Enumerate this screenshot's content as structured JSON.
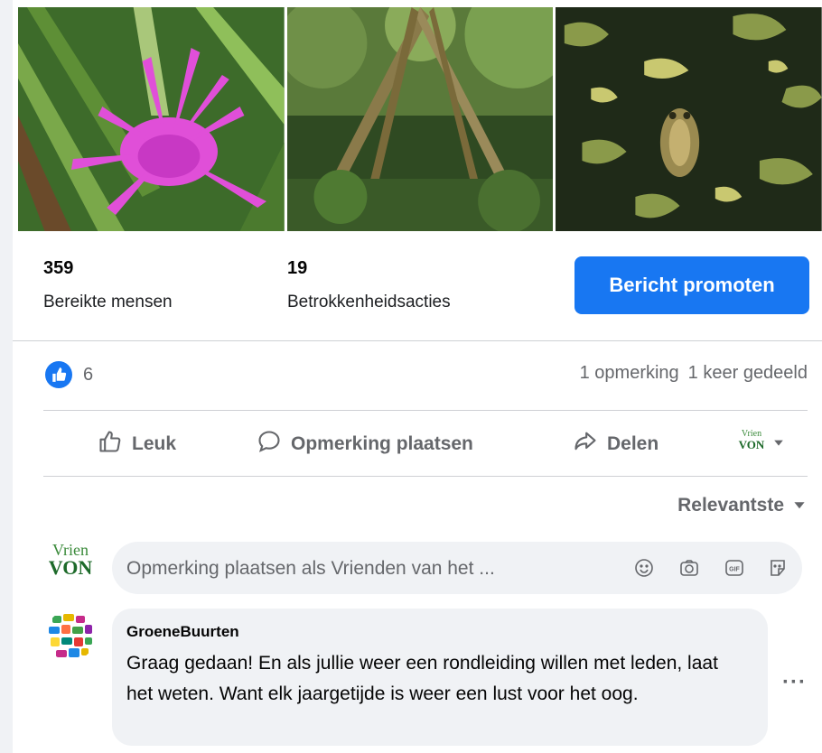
{
  "stats": {
    "reach_value": "359",
    "reach_label": "Bereikte mensen",
    "engagement_value": "19",
    "engagement_label": "Betrokkenheidsacties",
    "promote_label": "Bericht promoten"
  },
  "reactions": {
    "count": "6",
    "comments": "1 opmerking",
    "shares": "1 keer gedeeld"
  },
  "actions": {
    "like": "Leuk",
    "comment": "Opmerking plaatsen",
    "share": "Delen"
  },
  "page_logo": {
    "top": "Vrien",
    "bottom": "VON"
  },
  "sort": {
    "label": "Relevantste"
  },
  "composer": {
    "placeholder": "Opmerking plaatsen als Vrienden van het ..."
  },
  "comment": {
    "author": "GroeneBuurten",
    "text": "Graag gedaan! En als jullie weer een rondleiding willen met leden, laat het weten. Want elk jaargetijde is weer een lust voor het oog.",
    "more": "···"
  },
  "colors": {
    "accent": "#1877f2",
    "bubble": "#f0f2f5",
    "secondary_text": "#65676b"
  }
}
